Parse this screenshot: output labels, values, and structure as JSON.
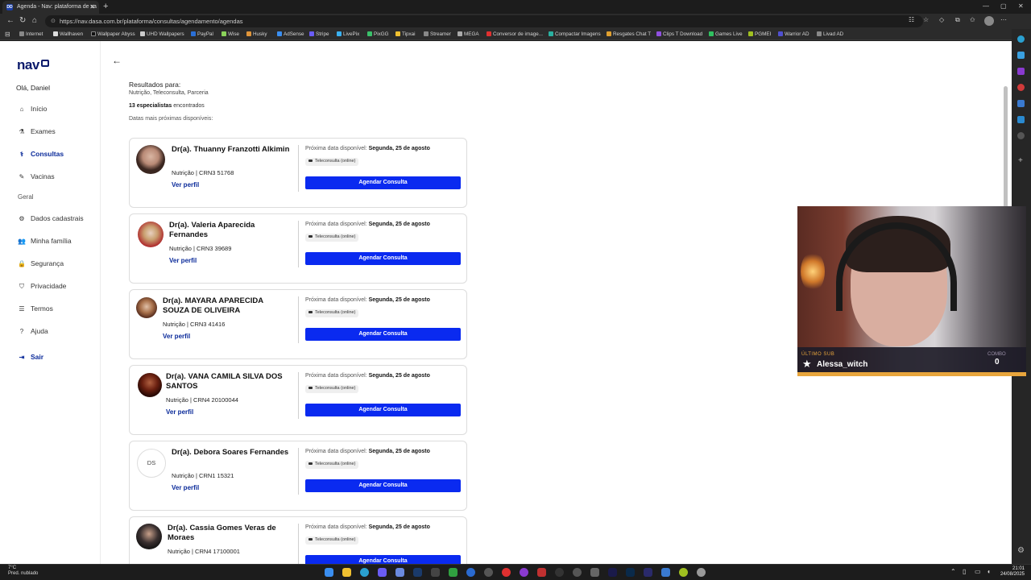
{
  "browser": {
    "tab_title": "Agenda - Nav: plataforma de sa",
    "tab_favicon": "DD",
    "url": "https://nav.dasa.com.br/plataforma/consultas/agendamento/agendas",
    "bookmarks": [
      "Internet",
      "Wallhaven",
      "Wallpaper Abyss",
      "UHD Wallpapers",
      "PayPal",
      "Wise",
      "Husky",
      "AdSense",
      "Stripe",
      "LivePix",
      "PixGG",
      "Tipxai",
      "Streamer",
      "MEGA",
      "Conversor de image...",
      "Compactar Imagens",
      "Resgates Chat T",
      "Clips T Download",
      "Games Live",
      "PGMEI",
      "Warrior AD",
      "Livad AD"
    ]
  },
  "sidebar": {
    "logo": "nav",
    "greeting": "Olá, Daniel",
    "items": [
      {
        "label": "Início",
        "icon": "home-icon"
      },
      {
        "label": "Exames",
        "icon": "flask-icon"
      },
      {
        "label": "Consultas",
        "icon": "stethoscope-icon"
      },
      {
        "label": "Vacinas",
        "icon": "syringe-icon"
      }
    ],
    "section_label": "Geral",
    "general_items": [
      {
        "label": "Dados cadastrais",
        "icon": "gear-icon"
      },
      {
        "label": "Minha família",
        "icon": "people-icon"
      },
      {
        "label": "Segurança",
        "icon": "lock-icon"
      },
      {
        "label": "Privacidade",
        "icon": "shield-icon"
      },
      {
        "label": "Termos",
        "icon": "document-icon"
      },
      {
        "label": "Ajuda",
        "icon": "help-icon"
      }
    ],
    "logout": "Sair"
  },
  "results": {
    "title": "Resultados para:",
    "filters": "Nutrição, Teleconsulta, Parceria",
    "count_bold": "13 especialistas",
    "count_rest": " encontrados",
    "dates_label": "Datas mais próximas disponíveis:"
  },
  "card_labels": {
    "next_label": "Próxima data disponível: ",
    "next_date": "Segunda, 25 de agosto",
    "tele": "Teleconsulta (online)",
    "perfil": "Ver perfil",
    "agendar": "Agendar Consulta"
  },
  "doctors": [
    {
      "name": "Dr(a). Thuanny Franzotti Alkimin",
      "spec": "Nutrição | CRN3 51768"
    },
    {
      "name": "Dr(a). Valeria Aparecida Fernandes",
      "spec": "Nutrição | CRN3 39689"
    },
    {
      "name": "Dr(a). MAYARA APARECIDA SOUZA DE OLIVEIRA",
      "spec": "Nutrição | CRN3 41416"
    },
    {
      "name": "Dr(a). VANA CAMILA SILVA DOS SANTOS",
      "spec": "Nutrição | CRN4 20100044"
    },
    {
      "name": "Dr(a). Debora Soares Fernandes",
      "spec": "Nutrição | CRN1 15321",
      "initials": "DS"
    },
    {
      "name": "Dr(a). Cassia Gomes Veras de Moraes",
      "spec": "Nutrição | CRN4 17100001"
    }
  ],
  "stream_overlay": {
    "sub_label": "ÚLTIMO SUB",
    "sub_name": "Alessa_witch",
    "combo_label": "COMBO",
    "combo_value": "0"
  },
  "taskbar": {
    "weather_temp": "7°C",
    "weather_desc": "Pred. nublado",
    "time": "21:01",
    "date": "24/08/2025"
  },
  "colors": {
    "brand": "#0a1a6b",
    "accent_button": "#0a2af0",
    "link": "#0a2a9a"
  }
}
